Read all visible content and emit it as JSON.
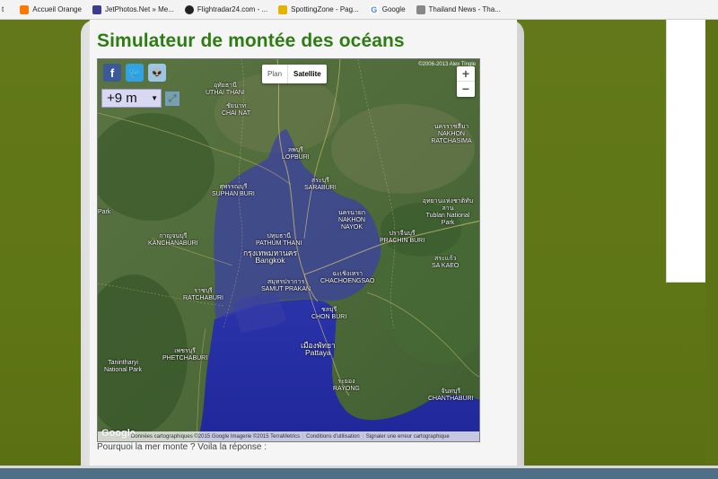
{
  "bookmarks": [
    {
      "label": "t",
      "color": ""
    },
    {
      "label": "Accueil Orange",
      "color": "#ff7900"
    },
    {
      "label": "JetPhotos.Net » Me...",
      "color": "#3b3b8f"
    },
    {
      "label": "Flightradar24.com - ...",
      "color": "#222222"
    },
    {
      "label": "SpottingZone - Pag...",
      "color": "#e6b400"
    },
    {
      "label": "Google",
      "color": "#4285f4"
    },
    {
      "label": "Thailand News - Tha...",
      "color": "#888888"
    }
  ],
  "page": {
    "title": "Simulateur de montée des océans",
    "caption": "Pourquoi la mer monte ? Voila la réponse :"
  },
  "map": {
    "level": "+9 m",
    "type_plan": "Plan",
    "type_satellite": "Satellite",
    "copyright_top": "©2006-2013 Alex Tingle",
    "zoom_in": "+",
    "zoom_out": "−",
    "google": "Google",
    "footer": {
      "data": "Données cartographiques ©2015 Google Imagerie ©2015 TerraMetrics",
      "terms": "Conditions d'utilisation",
      "report": "Signaler une erreur cartographique"
    },
    "places": [
      {
        "th": "อุทัยธานี",
        "en": "UTHAI THANI"
      },
      {
        "th": "ชัยนาท",
        "en": "CHAI NAT"
      },
      {
        "th": "ลพบุรี",
        "en": "LOPBURI"
      },
      {
        "th": "นครราชสีมา",
        "en": "NAKHON RATCHASIMA"
      },
      {
        "th": "สุพรรณบุรี",
        "en": "SUPHAN BURI"
      },
      {
        "th": "สระบุรี",
        "en": "SARABURI"
      },
      {
        "th": "อุทยานแห่งชาติทับลาน",
        "en": "Tublan National Park"
      },
      {
        "th": "นครนายก",
        "en": "NAKHON NAYOK"
      },
      {
        "th": "ปราจีนบุรี",
        "en": "PRACHIN BURI"
      },
      {
        "th": "กาญจนบุรี",
        "en": "KANCHANABURI"
      },
      {
        "th": "ปทุมธานี",
        "en": "PATHUM THANI"
      },
      {
        "th": "กรุงเทพมหานคร",
        "en": "Bangkok"
      },
      {
        "th": "สระแก้ว",
        "en": "SA KAEO"
      },
      {
        "th": "ราชบุรี",
        "en": "RATCHABURI"
      },
      {
        "th": "สมุทรปราการ",
        "en": "SAMUT PRAKAN"
      },
      {
        "th": "ฉะเชิงเทรา",
        "en": "CHACHOENGSAO"
      },
      {
        "th": "ชลบุรี",
        "en": "CHON BURI"
      },
      {
        "th": "เพชรบุรี",
        "en": "PHETCHABURI"
      },
      {
        "th": "เมืองพัทยา",
        "en": "Pattaya"
      },
      {
        "th": "ระยอง",
        "en": "RAYONG"
      },
      {
        "th": "จันทบุรี",
        "en": "CHANTHABURI"
      },
      {
        "th": "",
        "en": "Tanintharyi National Park"
      },
      {
        "th": "",
        "en": "Park"
      }
    ]
  }
}
